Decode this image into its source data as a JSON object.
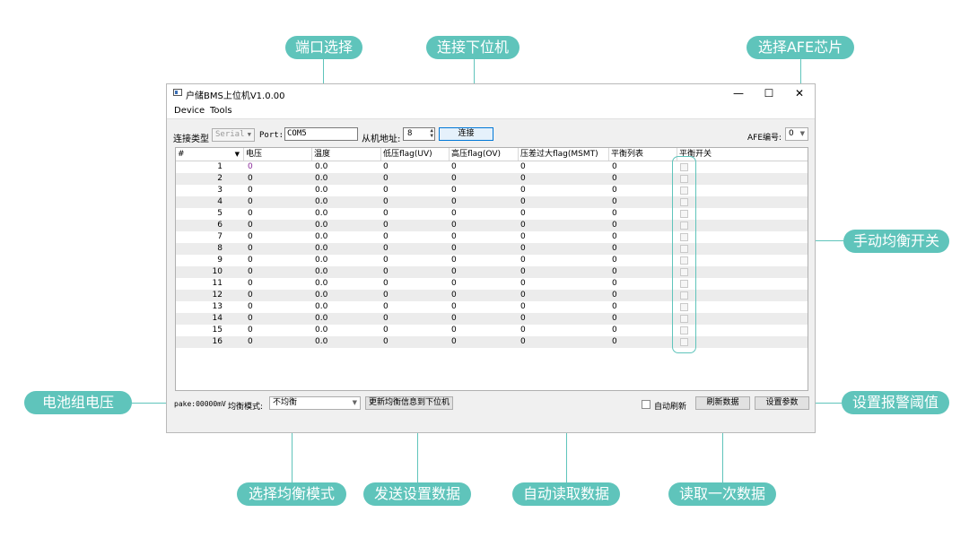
{
  "callouts": {
    "port_select": "端口选择",
    "connect_slave": "连接下位机",
    "select_afe": "选择AFE芯片",
    "manual_balance": "手动均衡开关",
    "pack_voltage": "电池组电压",
    "set_alarm": "设置报警阈值",
    "select_balance_mode": "选择均衡模式",
    "send_settings": "发送设置数据",
    "auto_read": "自动读取数据",
    "read_once": "读取一次数据"
  },
  "window": {
    "title": "户储BMS上位机V1.0.00",
    "minimize": "—",
    "maximize": "☐",
    "close": "✕"
  },
  "menu": {
    "device": "Device",
    "tools": "Tools"
  },
  "toolbar": {
    "conn_type_label": "连接类型",
    "conn_type_value": "Serial",
    "port_label": "Port:",
    "port_value": "COM5",
    "slave_addr_label": "从机地址:",
    "slave_addr_value": "8",
    "connect_button": "连接",
    "afe_label": "AFE编号:",
    "afe_value": "0"
  },
  "table": {
    "columns": [
      "#",
      "电压",
      "温度",
      "低压flag(UV)",
      "高压flag(OV)",
      "压差过大flag(MSMT)",
      "平衡列表",
      "平衡开关"
    ],
    "rows": [
      {
        "n": "1",
        "v": "0",
        "t": "0.0",
        "uv": "0",
        "ov": "0",
        "msmt": "0",
        "bal": "0"
      },
      {
        "n": "2",
        "v": "0",
        "t": "0.0",
        "uv": "0",
        "ov": "0",
        "msmt": "0",
        "bal": "0"
      },
      {
        "n": "3",
        "v": "0",
        "t": "0.0",
        "uv": "0",
        "ov": "0",
        "msmt": "0",
        "bal": "0"
      },
      {
        "n": "4",
        "v": "0",
        "t": "0.0",
        "uv": "0",
        "ov": "0",
        "msmt": "0",
        "bal": "0"
      },
      {
        "n": "5",
        "v": "0",
        "t": "0.0",
        "uv": "0",
        "ov": "0",
        "msmt": "0",
        "bal": "0"
      },
      {
        "n": "6",
        "v": "0",
        "t": "0.0",
        "uv": "0",
        "ov": "0",
        "msmt": "0",
        "bal": "0"
      },
      {
        "n": "7",
        "v": "0",
        "t": "0.0",
        "uv": "0",
        "ov": "0",
        "msmt": "0",
        "bal": "0"
      },
      {
        "n": "8",
        "v": "0",
        "t": "0.0",
        "uv": "0",
        "ov": "0",
        "msmt": "0",
        "bal": "0"
      },
      {
        "n": "9",
        "v": "0",
        "t": "0.0",
        "uv": "0",
        "ov": "0",
        "msmt": "0",
        "bal": "0"
      },
      {
        "n": "10",
        "v": "0",
        "t": "0.0",
        "uv": "0",
        "ov": "0",
        "msmt": "0",
        "bal": "0"
      },
      {
        "n": "11",
        "v": "0",
        "t": "0.0",
        "uv": "0",
        "ov": "0",
        "msmt": "0",
        "bal": "0"
      },
      {
        "n": "12",
        "v": "0",
        "t": "0.0",
        "uv": "0",
        "ov": "0",
        "msmt": "0",
        "bal": "0"
      },
      {
        "n": "13",
        "v": "0",
        "t": "0.0",
        "uv": "0",
        "ov": "0",
        "msmt": "0",
        "bal": "0"
      },
      {
        "n": "14",
        "v": "0",
        "t": "0.0",
        "uv": "0",
        "ov": "0",
        "msmt": "0",
        "bal": "0"
      },
      {
        "n": "15",
        "v": "0",
        "t": "0.0",
        "uv": "0",
        "ov": "0",
        "msmt": "0",
        "bal": "0"
      },
      {
        "n": "16",
        "v": "0",
        "t": "0.0",
        "uv": "0",
        "ov": "0",
        "msmt": "0",
        "bal": "0"
      }
    ]
  },
  "status": {
    "pack_voltage": "pake:00000mV",
    "balance_mode_label": "均衡模式:",
    "balance_mode_value": "不均衡",
    "send_button": "更新均衡信息到下位机",
    "auto_refresh_label": "自动刷新",
    "refresh_button": "刷新数据",
    "settings_button": "设置参数"
  },
  "colors": {
    "accent": "#5fc4bb",
    "first_voltage": "#8a2b9a"
  }
}
